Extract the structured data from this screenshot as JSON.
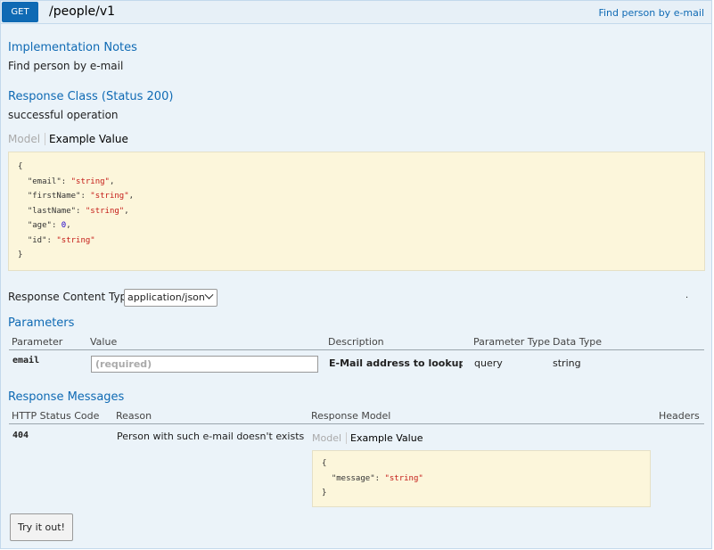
{
  "header": {
    "method": "GET",
    "path": "/people/v1",
    "summary": "Find person by e-mail"
  },
  "implementation": {
    "title": "Implementation Notes",
    "text": "Find person by e-mail"
  },
  "response_class": {
    "title": "Response Class (Status 200)",
    "text": "successful operation",
    "tab_model": "Model",
    "tab_example": "Example Value",
    "example": {
      "open": "{",
      "close": "}",
      "fields": [
        {
          "key": "\"email\"",
          "value": "\"string\"",
          "suffix": ","
        },
        {
          "key": "\"firstName\"",
          "value": "\"string\"",
          "suffix": ","
        },
        {
          "key": "\"lastName\"",
          "value": "\"string\"",
          "suffix": ","
        },
        {
          "key": "\"age\"",
          "value": "0",
          "suffix": ","
        },
        {
          "key": "\"id\"",
          "value": "\"string\"",
          "suffix": ""
        }
      ]
    }
  },
  "content_type": {
    "label": "Response Content Type",
    "selected": "application/json",
    "dot": "."
  },
  "parameters": {
    "title": "Parameters",
    "headers": [
      "Parameter",
      "Value",
      "Description",
      "Parameter Type",
      "Data Type"
    ],
    "rows": [
      {
        "name": "email",
        "placeholder": "(required)",
        "description": "E-Mail address to lookup for",
        "param_type": "query",
        "data_type": "string"
      }
    ]
  },
  "responses": {
    "title": "Response Messages",
    "headers": [
      "HTTP Status Code",
      "Reason",
      "Response Model",
      "Headers"
    ],
    "rows": [
      {
        "code": "404",
        "reason": "Person with such e-mail doesn't exists",
        "tab_model": "Model",
        "tab_example": "Example Value",
        "example": {
          "open": "{",
          "key": "\"message\"",
          "value": "\"string\"",
          "close": "}"
        }
      }
    ]
  },
  "try_button": "Try it out!"
}
